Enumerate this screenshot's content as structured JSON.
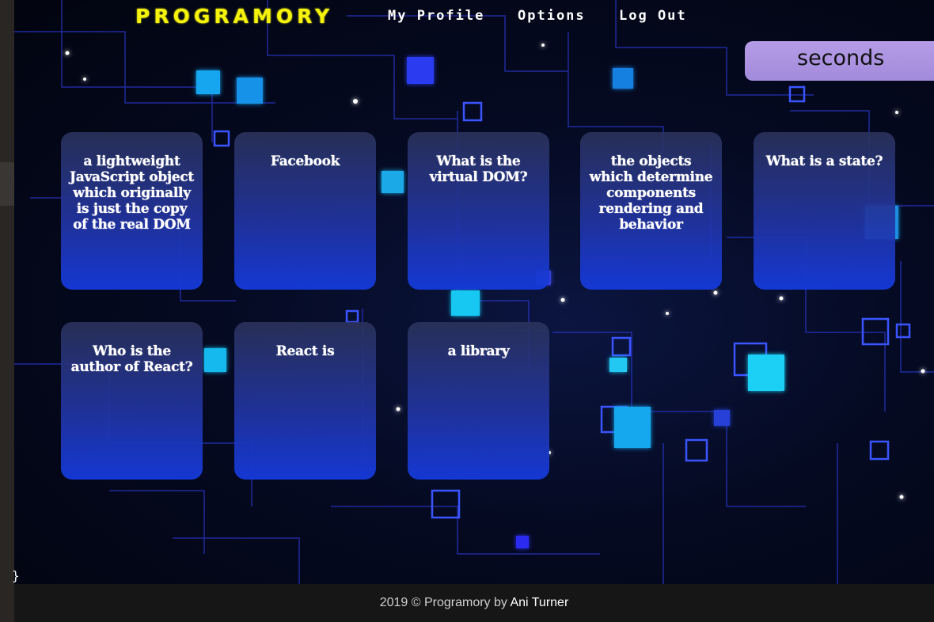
{
  "nav": {
    "brand": "PROGRAMORY",
    "links": [
      "My Profile",
      "Options",
      "Log Out"
    ]
  },
  "timer": {
    "label": "seconds"
  },
  "cards": [
    {
      "text": "a lightweight JavaScript object which originally is just the copy of the real DOM"
    },
    {
      "text": "Facebook"
    },
    {
      "text": "What is the virtual DOM?"
    },
    {
      "text": "the objects which determine components rendering and behavior"
    },
    {
      "text": "What is a state?"
    },
    {
      "text": "Who is the author of React?"
    },
    {
      "text": "React is"
    },
    {
      "text": "a library"
    }
  ],
  "stray_text": "}",
  "footer": {
    "prefix": "2019 © Programory by",
    "author": "Ani Turner"
  },
  "colors": {
    "brand": "#f5f20c",
    "timer_bg": "#b49ce6",
    "card_gradient_top": "#2a325a",
    "card_gradient_bottom": "#153adc",
    "footer_bg": "#161616"
  }
}
